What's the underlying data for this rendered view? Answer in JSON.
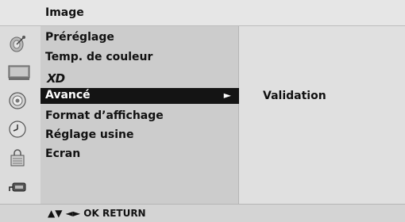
{
  "header": {
    "title": "Image"
  },
  "menu": {
    "items": [
      {
        "label": "Préréglage"
      },
      {
        "label": "Temp. de couleur"
      },
      {
        "label": "XD",
        "is_logo": true
      },
      {
        "label": "Avancé",
        "selected": true,
        "arrow": "►"
      },
      {
        "label": "Format d’affichage"
      },
      {
        "label": "Réglage usine"
      },
      {
        "label": "Ecran"
      }
    ]
  },
  "submenu": {
    "label": "Validation"
  },
  "footer": {
    "hint": "▲▼ ◄► OK RETURN"
  },
  "icons": [
    "satellite-dish-icon",
    "tv-screen-icon",
    "speaker-icon",
    "clock-icon",
    "lock-icon",
    "input-plug-icon"
  ],
  "colors": {
    "selected_bg": "#141414",
    "selected_text": "#ffffff"
  }
}
